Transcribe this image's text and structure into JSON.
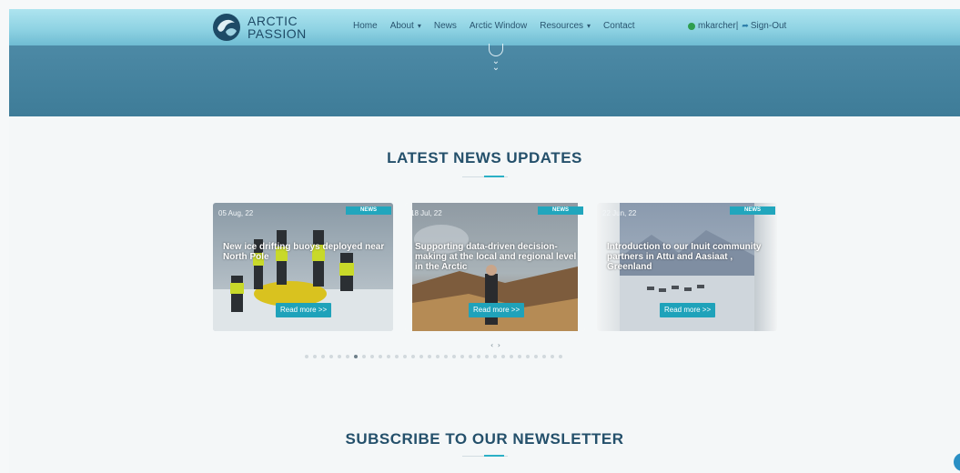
{
  "header": {
    "logo_line1": "ARCTIC",
    "logo_line2": "PASSION",
    "nav": [
      {
        "label": "Home",
        "dropdown": false
      },
      {
        "label": "About",
        "dropdown": true
      },
      {
        "label": "News",
        "dropdown": false
      },
      {
        "label": "Arctic Window",
        "dropdown": false
      },
      {
        "label": "Resources",
        "dropdown": true
      },
      {
        "label": "Contact",
        "dropdown": false
      }
    ],
    "username": "mkarcher",
    "separator": "|",
    "signout_label": "Sign-Out"
  },
  "news": {
    "section_title": "LATEST NEWS UPDATES",
    "cards": [
      {
        "date": "05 Aug, 22",
        "badge": "NEWS",
        "title": "New ice drifting buoys deployed near North Pole",
        "button": "Read more >>"
      },
      {
        "date": "18 Jul, 22",
        "badge": "NEWS",
        "title": "Supporting data-driven decision-making at the local and regional level in the Arctic",
        "button": "Read more >>"
      },
      {
        "date": "22 Jun, 22",
        "badge": "NEWS",
        "title": "Introduction to our Inuit community partners in Attu and Aasiaat , Greenland",
        "button": "Read more >>"
      }
    ],
    "prev_arrow": "‹",
    "next_arrow": "›",
    "carousel_pages": 32,
    "active_page": 6
  },
  "newsletter": {
    "section_title": "SUBSCRIBE TO OUR NEWSLETTER"
  },
  "colors": {
    "accent": "#21a6bd",
    "navy": "#24506b",
    "hero": "#3e7c98"
  }
}
